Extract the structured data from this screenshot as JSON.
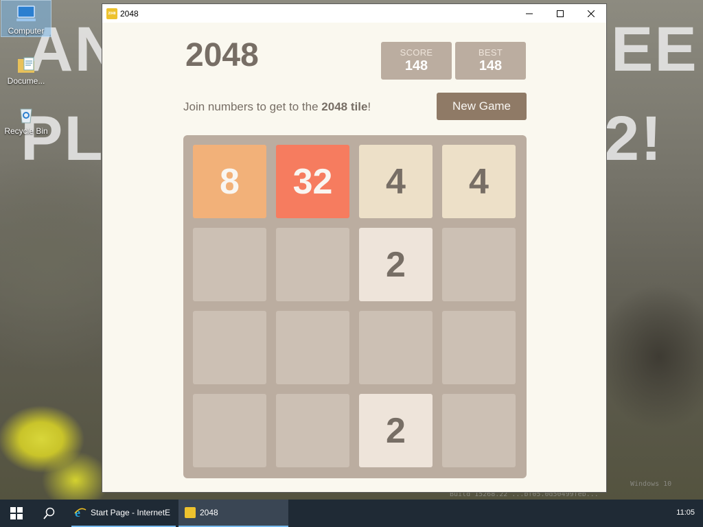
{
  "desktop": {
    "wallpaper_text_1": "AN",
    "wallpaper_text_2": "PL",
    "wallpaper_text_3": "EE",
    "wallpaper_text_4": "2!",
    "icons": [
      {
        "label": "Computer",
        "icon": "computer-icon"
      },
      {
        "label": "Docume...",
        "icon": "documents-icon"
      },
      {
        "label": "Recycle Bin",
        "icon": "recycle-bin-icon"
      }
    ],
    "watermark_1": "Windows 10",
    "watermark_2": "Build 15268.22 ...bf05.0d50499feb..."
  },
  "window": {
    "title": "2048",
    "app_icon_text": "2048"
  },
  "game": {
    "title": "2048",
    "score_label": "SCORE",
    "score": "148",
    "best_label": "BEST",
    "best": "148",
    "intro_prefix": "Join numbers to get to the ",
    "intro_bold": "2048 tile",
    "intro_suffix": "!",
    "new_game_label": "New Game",
    "board": [
      [
        "8",
        "32",
        "4",
        "4"
      ],
      [
        "",
        "",
        "2",
        ""
      ],
      [
        "",
        "",
        "",
        ""
      ],
      [
        "",
        "",
        "2",
        ""
      ]
    ],
    "tile_colors": {
      "2": {
        "bg": "#eee4da",
        "fg": "#776e65"
      },
      "4": {
        "bg": "#ede0c8",
        "fg": "#776e65"
      },
      "8": {
        "bg": "#f2b179",
        "fg": "#f9f6f2"
      },
      "32": {
        "bg": "#f67c5f",
        "fg": "#f9f6f2"
      }
    }
  },
  "taskbar": {
    "items": [
      {
        "label": "Start Page - InternetE",
        "icon": "internet-explorer-icon"
      },
      {
        "label": "2048",
        "icon": "app-2048-icon"
      }
    ],
    "clock": "11:05"
  }
}
